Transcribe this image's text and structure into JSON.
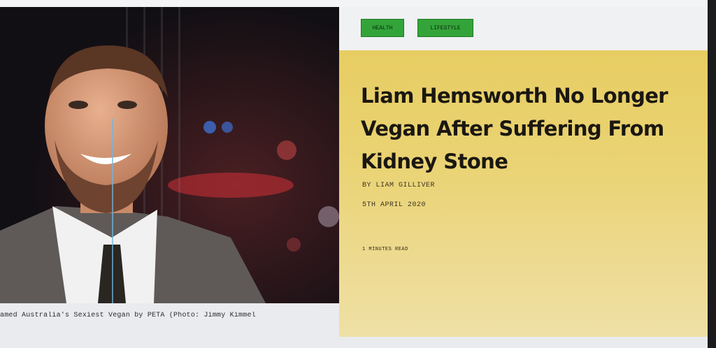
{
  "article": {
    "tags": [
      "HEALTH",
      "LIFESTYLE"
    ],
    "title": "Liam Hemsworth No Longer Vegan After Suffering From Kidney Stone",
    "byline": "BY LIAM GILLIVER",
    "date": "5TH APRIL 2020",
    "read_time": "1 MINUTES READ",
    "image_caption": "amed Australia's Sexiest Vegan by PETA (Photo: Jimmy Kimmel"
  },
  "colors": {
    "tag_bg": "#33a43a",
    "panel_bg": "#e7cd62",
    "title": "#1a1712"
  }
}
